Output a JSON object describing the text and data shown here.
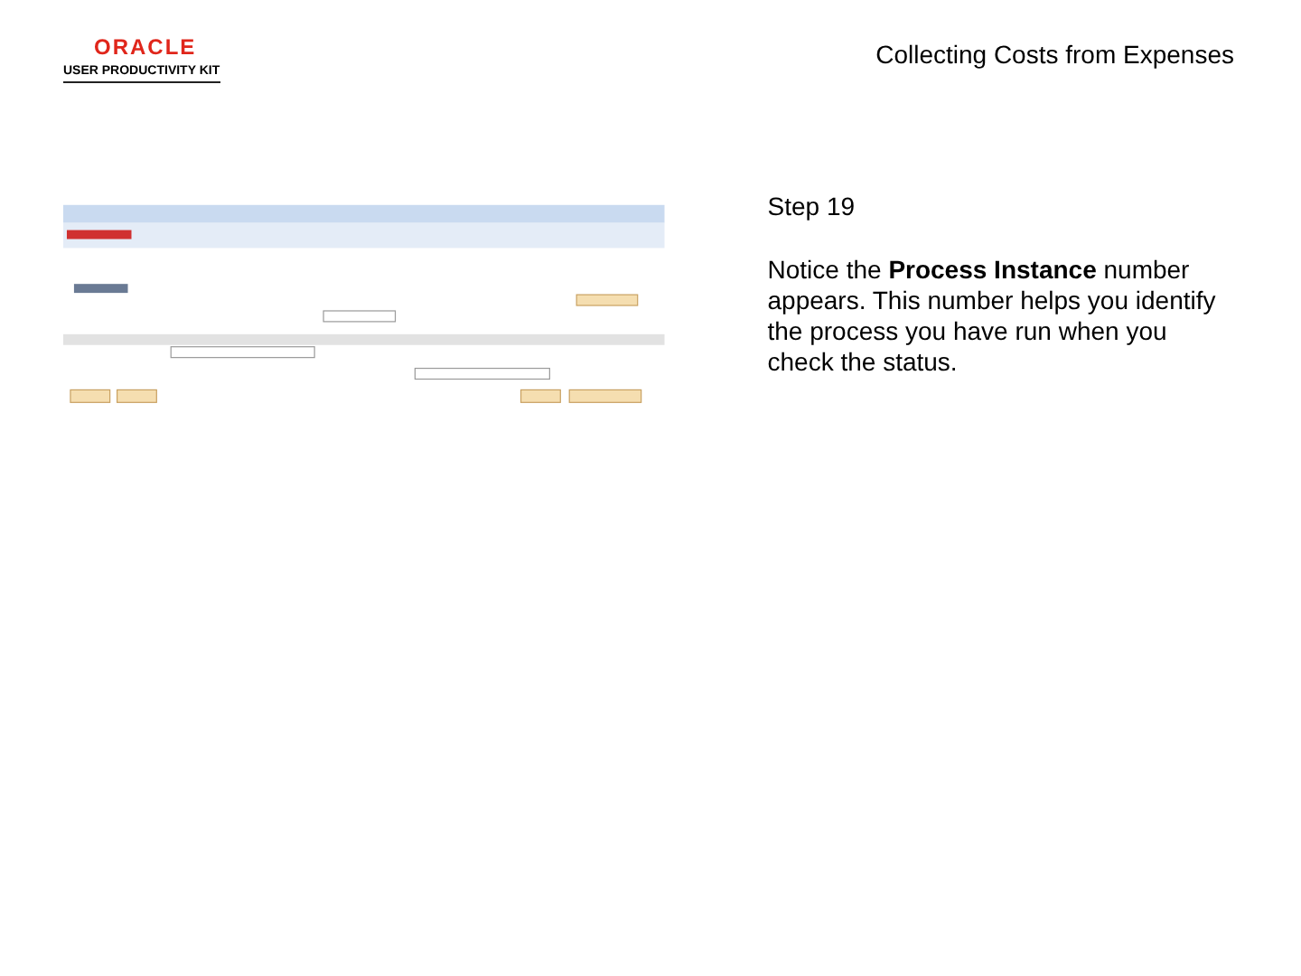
{
  "header": {
    "title": "Collecting Costs from Expenses"
  },
  "logo": {
    "brand": "ORACLE",
    "product": "USER PRODUCTIVITY KIT"
  },
  "content": {
    "step": "Step 19",
    "instruction": "Notice the **Process Instance** number appears. This number helps you identify the process you have run when you check the status."
  }
}
